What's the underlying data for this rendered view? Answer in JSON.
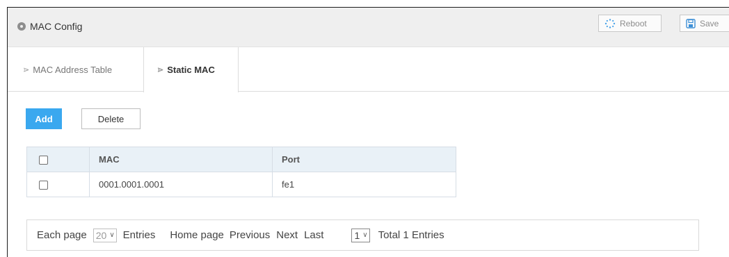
{
  "header": {
    "title": "MAC Config",
    "reboot_label": "Reboot",
    "save_label": "Save"
  },
  "tabs": [
    {
      "label": "MAC Address Table",
      "active": false
    },
    {
      "label": "Static MAC",
      "active": true
    }
  ],
  "toolbar": {
    "add_label": "Add",
    "delete_label": "Delete"
  },
  "table": {
    "columns": [
      "MAC",
      "Port"
    ],
    "rows": [
      {
        "mac": "0001.0001.0001",
        "port": "fe1"
      }
    ]
  },
  "pager": {
    "each_page_label": "Each page",
    "page_size": "20",
    "entries_label": "Entries",
    "home_label": "Home page",
    "previous_label": "Previous",
    "next_label": "Next",
    "last_label": "Last",
    "current_page": "1",
    "total_label": "Total 1 Entries"
  },
  "colors": {
    "accent": "#3aa8ef",
    "header_bg": "#efefef",
    "table_header_bg": "#e9f1f7"
  }
}
